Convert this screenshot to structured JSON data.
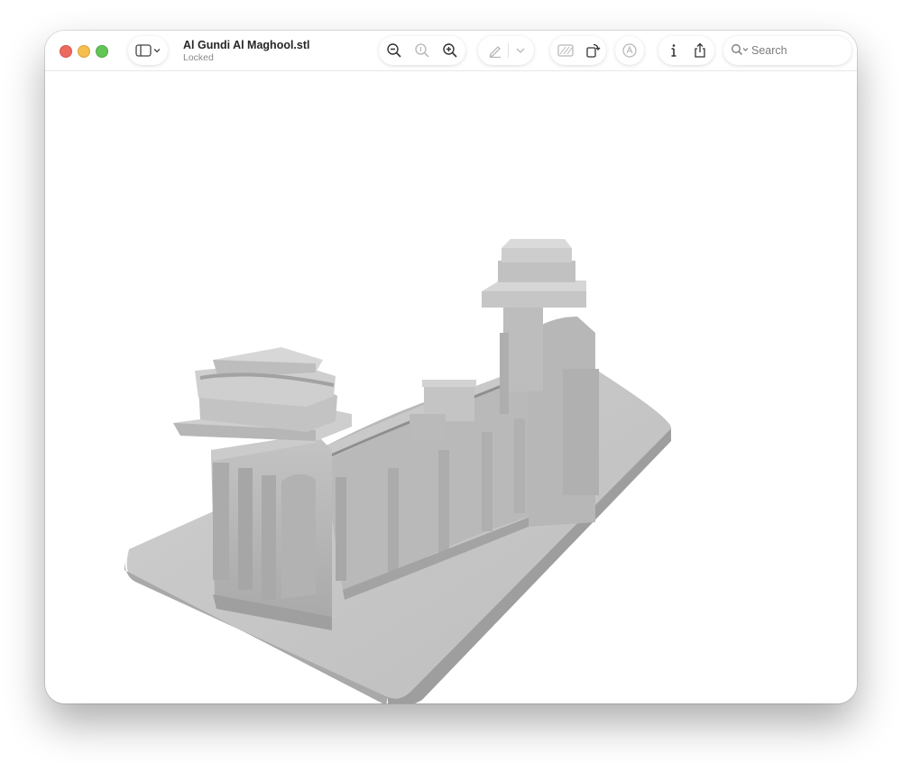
{
  "window": {
    "title": "Al Gundi Al Maghool.stl",
    "subtitle": "Locked"
  },
  "toolbar": {
    "sidebar_toggle_icon": "sidebar-icon",
    "zoom_out_icon": "zoom-out-icon",
    "actual_size_icon": "actual-size-icon",
    "zoom_in_icon": "zoom-in-icon",
    "markup_icon": "pencil-icon",
    "markup_menu_icon": "chevron-down-icon",
    "background_icon": "checkerboard-icon",
    "rotate_icon": "rotate-icon",
    "annotate_icon": "markup-circle-icon",
    "info_icon": "info-icon",
    "share_icon": "share-icon",
    "search_icon": "magnifier-icon",
    "search_placeholder": "Search"
  },
  "viewer": {
    "model": "3D model of a ruined colonnade with two towers on a rectangular base",
    "model_color": "#b3b3b3",
    "background": "#ffffff"
  }
}
